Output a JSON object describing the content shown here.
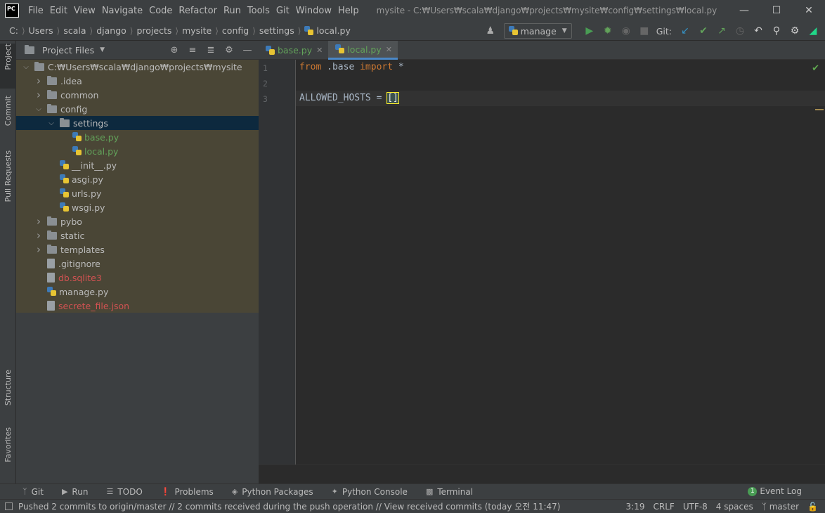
{
  "titlebar": {
    "logo": "PC",
    "menu": [
      "File",
      "Edit",
      "View",
      "Navigate",
      "Code",
      "Refactor",
      "Run",
      "Tools",
      "Git",
      "Window",
      "Help"
    ],
    "title": "mysite - C:₩Users₩scala₩django₩projects₩mysite₩config₩settings₩local.py"
  },
  "breadcrumb": [
    "C:",
    "Users",
    "scala",
    "django",
    "projects",
    "mysite",
    "config",
    "settings",
    "local.py"
  ],
  "toolbar": {
    "run_config": "manage",
    "git_label": "Git:"
  },
  "left_stripe": {
    "project": "Project",
    "commit": "Commit",
    "pull_requests": "Pull Requests",
    "structure": "Structure",
    "favorites": "Favorites"
  },
  "project_panel": {
    "title": "Project Files",
    "tree": [
      {
        "label": "C:₩Users₩scala₩django₩projects₩mysite",
        "depth": 0,
        "kind": "folder",
        "expanded": true,
        "color": "normal"
      },
      {
        "label": ".idea",
        "depth": 1,
        "kind": "folder",
        "expanded": false,
        "color": "normal"
      },
      {
        "label": "common",
        "depth": 1,
        "kind": "folder",
        "expanded": false,
        "color": "normal"
      },
      {
        "label": "config",
        "depth": 1,
        "kind": "folder",
        "expanded": true,
        "color": "normal"
      },
      {
        "label": "settings",
        "depth": 2,
        "kind": "folder",
        "expanded": true,
        "color": "normal",
        "selected": true
      },
      {
        "label": "base.py",
        "depth": 3,
        "kind": "py",
        "color": "green"
      },
      {
        "label": "local.py",
        "depth": 3,
        "kind": "py",
        "color": "green"
      },
      {
        "label": "__init__.py",
        "depth": 2,
        "kind": "py",
        "color": "normal"
      },
      {
        "label": "asgi.py",
        "depth": 2,
        "kind": "py",
        "color": "normal"
      },
      {
        "label": "urls.py",
        "depth": 2,
        "kind": "py",
        "color": "normal"
      },
      {
        "label": "wsgi.py",
        "depth": 2,
        "kind": "py",
        "color": "normal"
      },
      {
        "label": "pybo",
        "depth": 1,
        "kind": "folder",
        "expanded": false,
        "color": "normal"
      },
      {
        "label": "static",
        "depth": 1,
        "kind": "folder",
        "expanded": false,
        "color": "normal"
      },
      {
        "label": "templates",
        "depth": 1,
        "kind": "folder",
        "expanded": false,
        "color": "normal"
      },
      {
        "label": ".gitignore",
        "depth": 1,
        "kind": "file",
        "color": "normal"
      },
      {
        "label": "db.sqlite3",
        "depth": 1,
        "kind": "file",
        "color": "red"
      },
      {
        "label": "manage.py",
        "depth": 1,
        "kind": "py",
        "color": "normal"
      },
      {
        "label": "secrete_file.json",
        "depth": 1,
        "kind": "file",
        "color": "red"
      }
    ]
  },
  "editor": {
    "tabs": [
      {
        "label": "base.py",
        "active": false
      },
      {
        "label": "local.py",
        "active": true
      }
    ],
    "line_numbers": [
      "1",
      "2",
      "3"
    ],
    "code": {
      "l1_from": "from",
      "l1_mod": " .base ",
      "l1_import": "import",
      "l1_star": " *",
      "l3_name": "ALLOWED_HOSTS = ",
      "l3_bracket": "[]"
    }
  },
  "tool_windows": [
    "Git",
    "Run",
    "TODO",
    "Problems",
    "Python Packages",
    "Python Console",
    "Terminal"
  ],
  "event_log": {
    "label": "Event Log",
    "count": "1"
  },
  "status": {
    "message": "Pushed 2 commits to origin/master // 2 commits received during the push operation // View received commits (today 오전 11:47)",
    "position": "3:19",
    "line_sep": "CRLF",
    "encoding": "UTF-8",
    "indent": "4 spaces",
    "branch": "master"
  },
  "colors": {
    "accent": "#4a88c7",
    "vcs_added": "#62a25a",
    "vcs_ignored": "#d25252",
    "keyword": "#cc7832"
  }
}
